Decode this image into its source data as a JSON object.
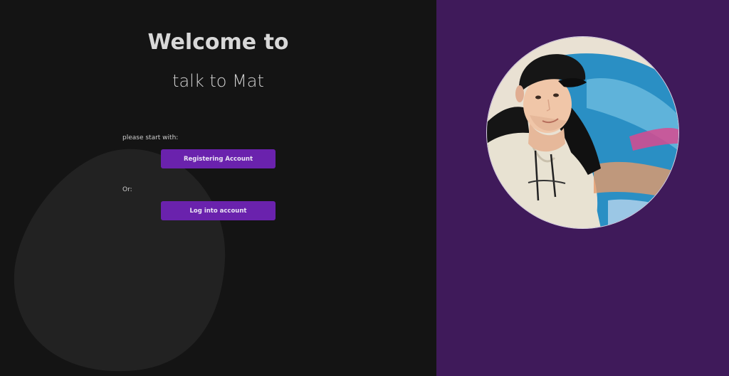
{
  "welcome": {
    "title": "Welcome to",
    "subtitle": "talk to Mat",
    "start_hint": "please start with:",
    "register_label": "Registering Account",
    "or_label": "Or:",
    "login_label": "Log into account"
  },
  "colors": {
    "left_background": "#141414",
    "right_background": "#3f1a5a",
    "button": "#6a22ad"
  },
  "icons": {
    "profile": "avatar-photo"
  }
}
